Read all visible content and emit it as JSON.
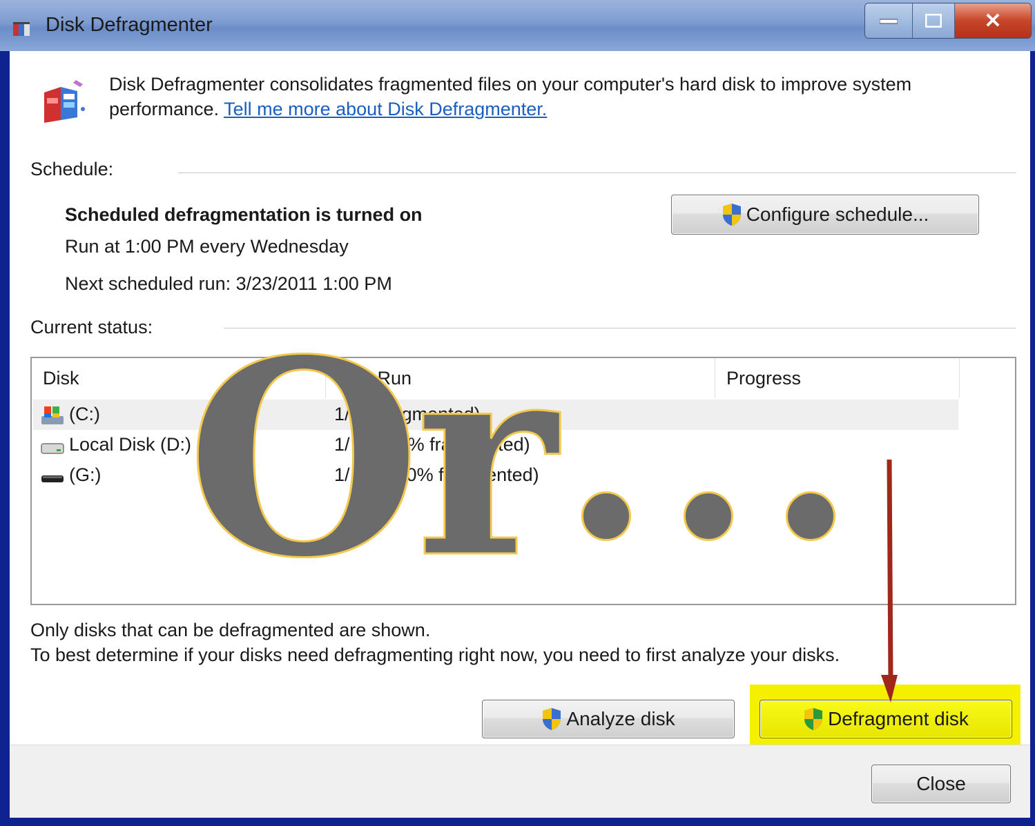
{
  "window": {
    "title": "Disk Defragmenter"
  },
  "description": {
    "text": "Disk Defragmenter consolidates fragmented files on your computer's hard disk to improve system performance.",
    "link": "Tell me more about Disk Defragmenter."
  },
  "schedule": {
    "label": "Schedule:",
    "status": "Scheduled defragmentation is turned on",
    "run_at": "Run at 1:00 PM every Wednesday",
    "next_run": "Next scheduled run: 3/23/2011 1:00 PM",
    "configure_button": "Configure schedule..."
  },
  "status": {
    "label": "Current status:",
    "columns": [
      "Disk",
      "Last Run",
      "Progress"
    ],
    "rows": [
      {
        "disk": "(C:)",
        "last_run": "1/ 1 6: agmented)",
        "progress": "",
        "icon": "system-drive-icon"
      },
      {
        "disk": "Local Disk (D:)",
        "last_run": "1/ 1 6: (0% fragmented)",
        "progress": "",
        "icon": "hard-drive-icon"
      },
      {
        "disk": "(G:)",
        "last_run": "1/ 11 3: (0% fragmented)",
        "progress": "",
        "icon": "removable-drive-icon"
      }
    ]
  },
  "info": {
    "line1": "Only disks that can be defragmented are shown.",
    "line2": "To best determine if your disks need defragmenting right now, you need to first analyze your disks."
  },
  "buttons": {
    "analyze": "Analyze disk",
    "defragment": "Defragment disk",
    "close": "Close"
  },
  "overlay": {
    "text": "Or"
  },
  "colors": {
    "highlight": "#f4f000",
    "arrow": "#a0281a",
    "overlay_fill": "#6b6b6b",
    "overlay_stroke": "#f2c94c"
  }
}
